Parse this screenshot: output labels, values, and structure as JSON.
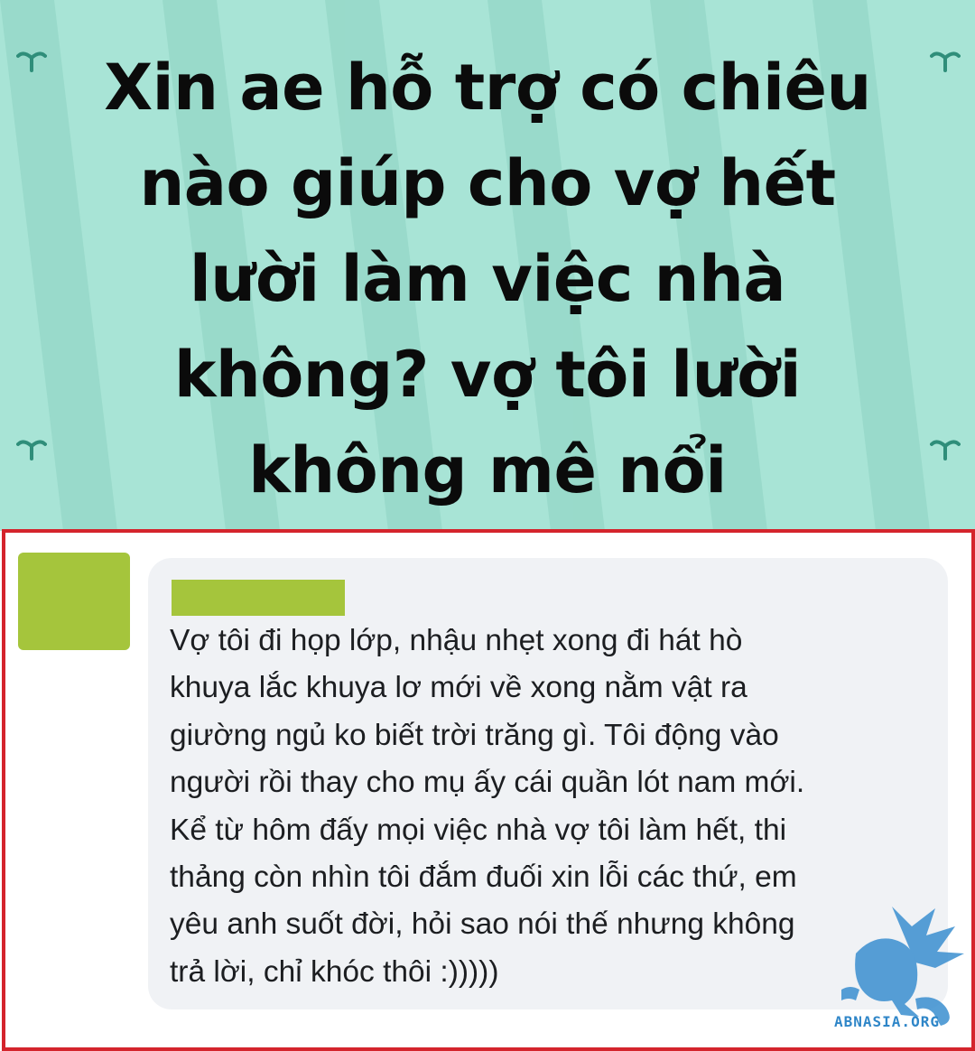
{
  "colors": {
    "header_bg": "#a8e4d6",
    "header_pattern": "#94d7c7",
    "header_icon": "#2f8e7a",
    "frame_border": "#d4242c",
    "placeholder_green": "#a5c53c",
    "bubble_bg": "#f0f2f5",
    "watermark_blue": "#2f86c8"
  },
  "headline": {
    "lines": [
      "Xin ae hỗ trợ có chiêu",
      "nào giúp cho vợ hết",
      "lười làm việc nhà",
      "không? vợ tôi lười",
      "không mê nổi"
    ]
  },
  "comment": {
    "lines": [
      "Vợ tôi đi họp lớp, nhậu nhẹt xong đi hát hò",
      "khuya lắc khuya lơ mới về xong nằm vật ra",
      "giường ngủ ko biết trời trăng gì. Tôi động vào",
      "người rồi thay cho mụ ấy cái quần lót nam mới.",
      "Kể từ hôm đấy mọi việc nhà vợ tôi làm hết, thi",
      "thảng còn nhìn tôi đắm đuối xin lỗi các thứ, em",
      "yêu anh suốt đời, hỏi sao nói thế nhưng không",
      "trả lời, chỉ khóc thôi :)))))"
    ]
  },
  "icons": {
    "header_decoration": "sprout-icon",
    "watermark_logo": "griffin-logo-icon"
  },
  "watermark": {
    "text": "ABNASIA.ORG"
  }
}
